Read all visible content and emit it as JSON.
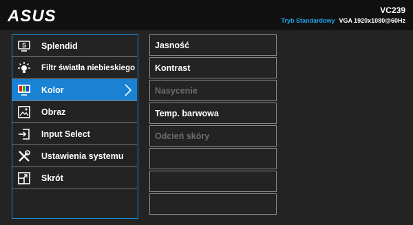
{
  "header": {
    "brand": "ASUS",
    "model": "VC239",
    "mode": "Tryb Standardowy",
    "signal": "VGA  1920x1080@60Hz"
  },
  "main_menu": {
    "items": [
      {
        "label": "Splendid",
        "icon": "splendid-icon",
        "selected": false
      },
      {
        "label": "Filtr światła niebieskiego",
        "icon": "bluelight-icon",
        "selected": false
      },
      {
        "label": "Kolor",
        "icon": "color-icon",
        "selected": true
      },
      {
        "label": "Obraz",
        "icon": "image-icon",
        "selected": false
      },
      {
        "label": "Input Select",
        "icon": "input-select-icon",
        "selected": false
      },
      {
        "label": "Ustawienia systemu",
        "icon": "system-settings-icon",
        "selected": false
      },
      {
        "label": "Skrót",
        "icon": "shortcut-icon",
        "selected": false
      }
    ]
  },
  "sub_menu": {
    "items": [
      {
        "label": "Jasność",
        "enabled": true
      },
      {
        "label": "Kontrast",
        "enabled": true
      },
      {
        "label": "Nasycenie",
        "enabled": false
      },
      {
        "label": "Temp. barwowa",
        "enabled": true
      },
      {
        "label": "Odcień skóry",
        "enabled": false
      },
      {
        "label": "",
        "enabled": false
      },
      {
        "label": "",
        "enabled": false
      },
      {
        "label": "",
        "enabled": false
      }
    ]
  },
  "colors": {
    "accent": "#1982d2",
    "mode_text": "#1ea0e6",
    "disabled_text": "#6c6c6c"
  }
}
